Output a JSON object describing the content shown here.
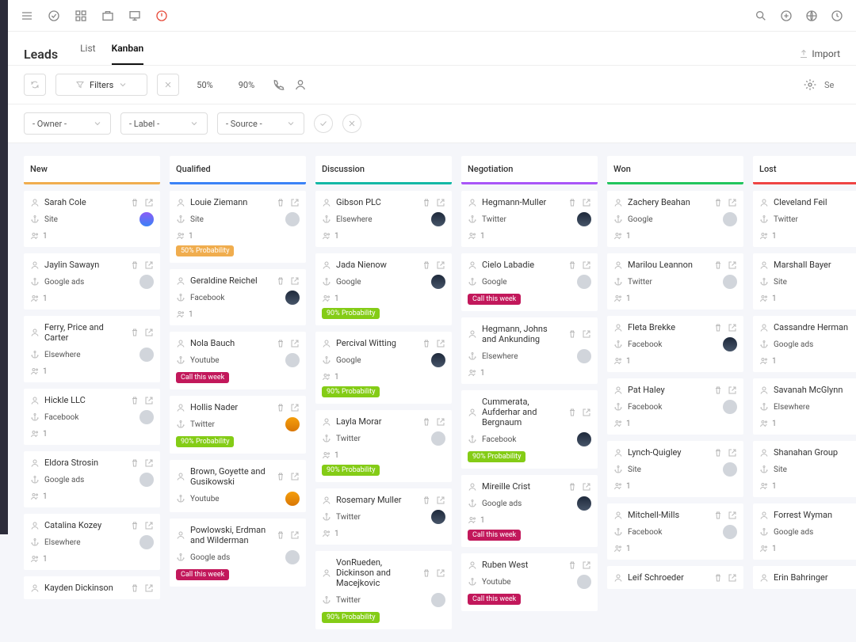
{
  "page": {
    "title": "Leads",
    "import": "Import"
  },
  "tabs": {
    "list": "List",
    "kanban": "Kanban"
  },
  "toolbar": {
    "filters": "Filters",
    "p50": "50%",
    "p90": "90%",
    "search_ph": "Se"
  },
  "selects": {
    "owner": "- Owner -",
    "label": "- Label -",
    "source": "- Source -"
  },
  "columns": [
    {
      "id": "new",
      "title": "New"
    },
    {
      "id": "qualified",
      "title": "Qualified"
    },
    {
      "id": "discussion",
      "title": "Discussion"
    },
    {
      "id": "negotiation",
      "title": "Negotiation"
    },
    {
      "id": "won",
      "title": "Won"
    },
    {
      "id": "lost",
      "title": "Lost"
    }
  ],
  "cards": {
    "new": [
      {
        "name": "Sarah Cole",
        "src": "Site",
        "cnt": "1",
        "av": "a1"
      },
      {
        "name": "Jaylin Sawayn",
        "src": "Google ads",
        "cnt": "1",
        "av": ""
      },
      {
        "name": "Ferry, Price and Carter",
        "src": "Elsewhere",
        "cnt": "1",
        "av": ""
      },
      {
        "name": "Hickle LLC",
        "src": "Facebook",
        "cnt": "1",
        "av": ""
      },
      {
        "name": "Eldora Strosin",
        "src": "Google ads",
        "cnt": "1",
        "av": ""
      },
      {
        "name": "Catalina Kozey",
        "src": "Elsewhere",
        "cnt": "1",
        "av": ""
      },
      {
        "name": "Kayden Dickinson",
        "src": "",
        "cnt": "",
        "av": ""
      }
    ],
    "qualified": [
      {
        "name": "Louie Ziemann",
        "src": "Site",
        "cnt": "1",
        "av": "",
        "badge": "50% Probability",
        "bcls": "p50"
      },
      {
        "name": "Geraldine Reichel",
        "src": "Facebook",
        "cnt": "1",
        "av": "a3"
      },
      {
        "name": "Nola Bauch",
        "src": "Youtube",
        "cnt": "",
        "av": "",
        "badge": "Call this week",
        "bcls": "call"
      },
      {
        "name": "Hollis Nader",
        "src": "Twitter",
        "cnt": "",
        "av": "a2",
        "badge": "90% Probability",
        "bcls": "p90"
      },
      {
        "name": "Brown, Goyette and Gusikowski",
        "src": "Youtube",
        "cnt": "",
        "av": "a2"
      },
      {
        "name": "Powlowski, Erdman and Wilderman",
        "src": "Google ads",
        "cnt": "",
        "av": "",
        "badge": "Call this week",
        "bcls": "call"
      }
    ],
    "discussion": [
      {
        "name": "Gibson PLC",
        "src": "Elsewhere",
        "cnt": "1",
        "av": "a3"
      },
      {
        "name": "Jada Nienow",
        "src": "Google",
        "cnt": "1",
        "av": "a3",
        "badge": "90% Probability",
        "bcls": "p90"
      },
      {
        "name": "Percival Witting",
        "src": "Google",
        "cnt": "1",
        "av": "a3",
        "badge": "90% Probability",
        "bcls": "p90"
      },
      {
        "name": "Layla Morar",
        "src": "Twitter",
        "cnt": "1",
        "av": "",
        "badge": "90% Probability",
        "bcls": "p90"
      },
      {
        "name": "Rosemary Muller",
        "src": "Twitter",
        "cnt": "1",
        "av": "a3"
      },
      {
        "name": "VonRueden, Dickinson and Macejkovic",
        "src": "Twitter",
        "cnt": "",
        "av": "",
        "badge": "90% Probability",
        "bcls": "p90"
      }
    ],
    "negotiation": [
      {
        "name": "Hegmann-Muller",
        "src": "Twitter",
        "cnt": "1",
        "av": "a3"
      },
      {
        "name": "Cielo Labadie",
        "src": "Google",
        "cnt": "",
        "av": "",
        "badge": "Call this week",
        "bcls": "call"
      },
      {
        "name": "Hegmann, Johns and Ankunding",
        "src": "Elsewhere",
        "cnt": "1",
        "av": ""
      },
      {
        "name": "Cummerata, Aufderhar and Bergnaum",
        "src": "Facebook",
        "cnt": "",
        "av": "a3",
        "badge": "90% Probability",
        "bcls": "p90"
      },
      {
        "name": "Mireille Crist",
        "src": "Google ads",
        "cnt": "1",
        "av": "a3",
        "badge": "Call this week",
        "bcls": "call"
      },
      {
        "name": "Ruben West",
        "src": "Youtube",
        "cnt": "",
        "av": "",
        "badge": "Call this week",
        "bcls": "call"
      }
    ],
    "won": [
      {
        "name": "Zachery Beahan",
        "src": "Google",
        "cnt": "1",
        "av": ""
      },
      {
        "name": "Marilou Leannon",
        "src": "Twitter",
        "cnt": "1",
        "av": ""
      },
      {
        "name": "Fleta Brekke",
        "src": "Facebook",
        "cnt": "1",
        "av": "a3"
      },
      {
        "name": "Pat Haley",
        "src": "Facebook",
        "cnt": "1",
        "av": ""
      },
      {
        "name": "Lynch-Quigley",
        "src": "Site",
        "cnt": "1",
        "av": ""
      },
      {
        "name": "Mitchell-Mills",
        "src": "Facebook",
        "cnt": "1",
        "av": ""
      },
      {
        "name": "Leif Schroeder",
        "src": "",
        "cnt": "",
        "av": ""
      }
    ],
    "lost": [
      {
        "name": "Cleveland Feil",
        "src": "Twitter",
        "cnt": "1",
        "av": "a2"
      },
      {
        "name": "Marshall Bayer",
        "src": "Site",
        "cnt": "1",
        "av": "a3"
      },
      {
        "name": "Cassandre Herman",
        "src": "Google ads",
        "cnt": "1",
        "av": ""
      },
      {
        "name": "Savanah McGlynn",
        "src": "Elsewhere",
        "cnt": "1",
        "av": "a2"
      },
      {
        "name": "Shanahan Group",
        "src": "Site",
        "cnt": "1",
        "av": ""
      },
      {
        "name": "Forrest Wyman",
        "src": "Google ads",
        "cnt": "1",
        "av": ""
      },
      {
        "name": "Erin Bahringer",
        "src": "",
        "cnt": "",
        "av": ""
      }
    ]
  }
}
